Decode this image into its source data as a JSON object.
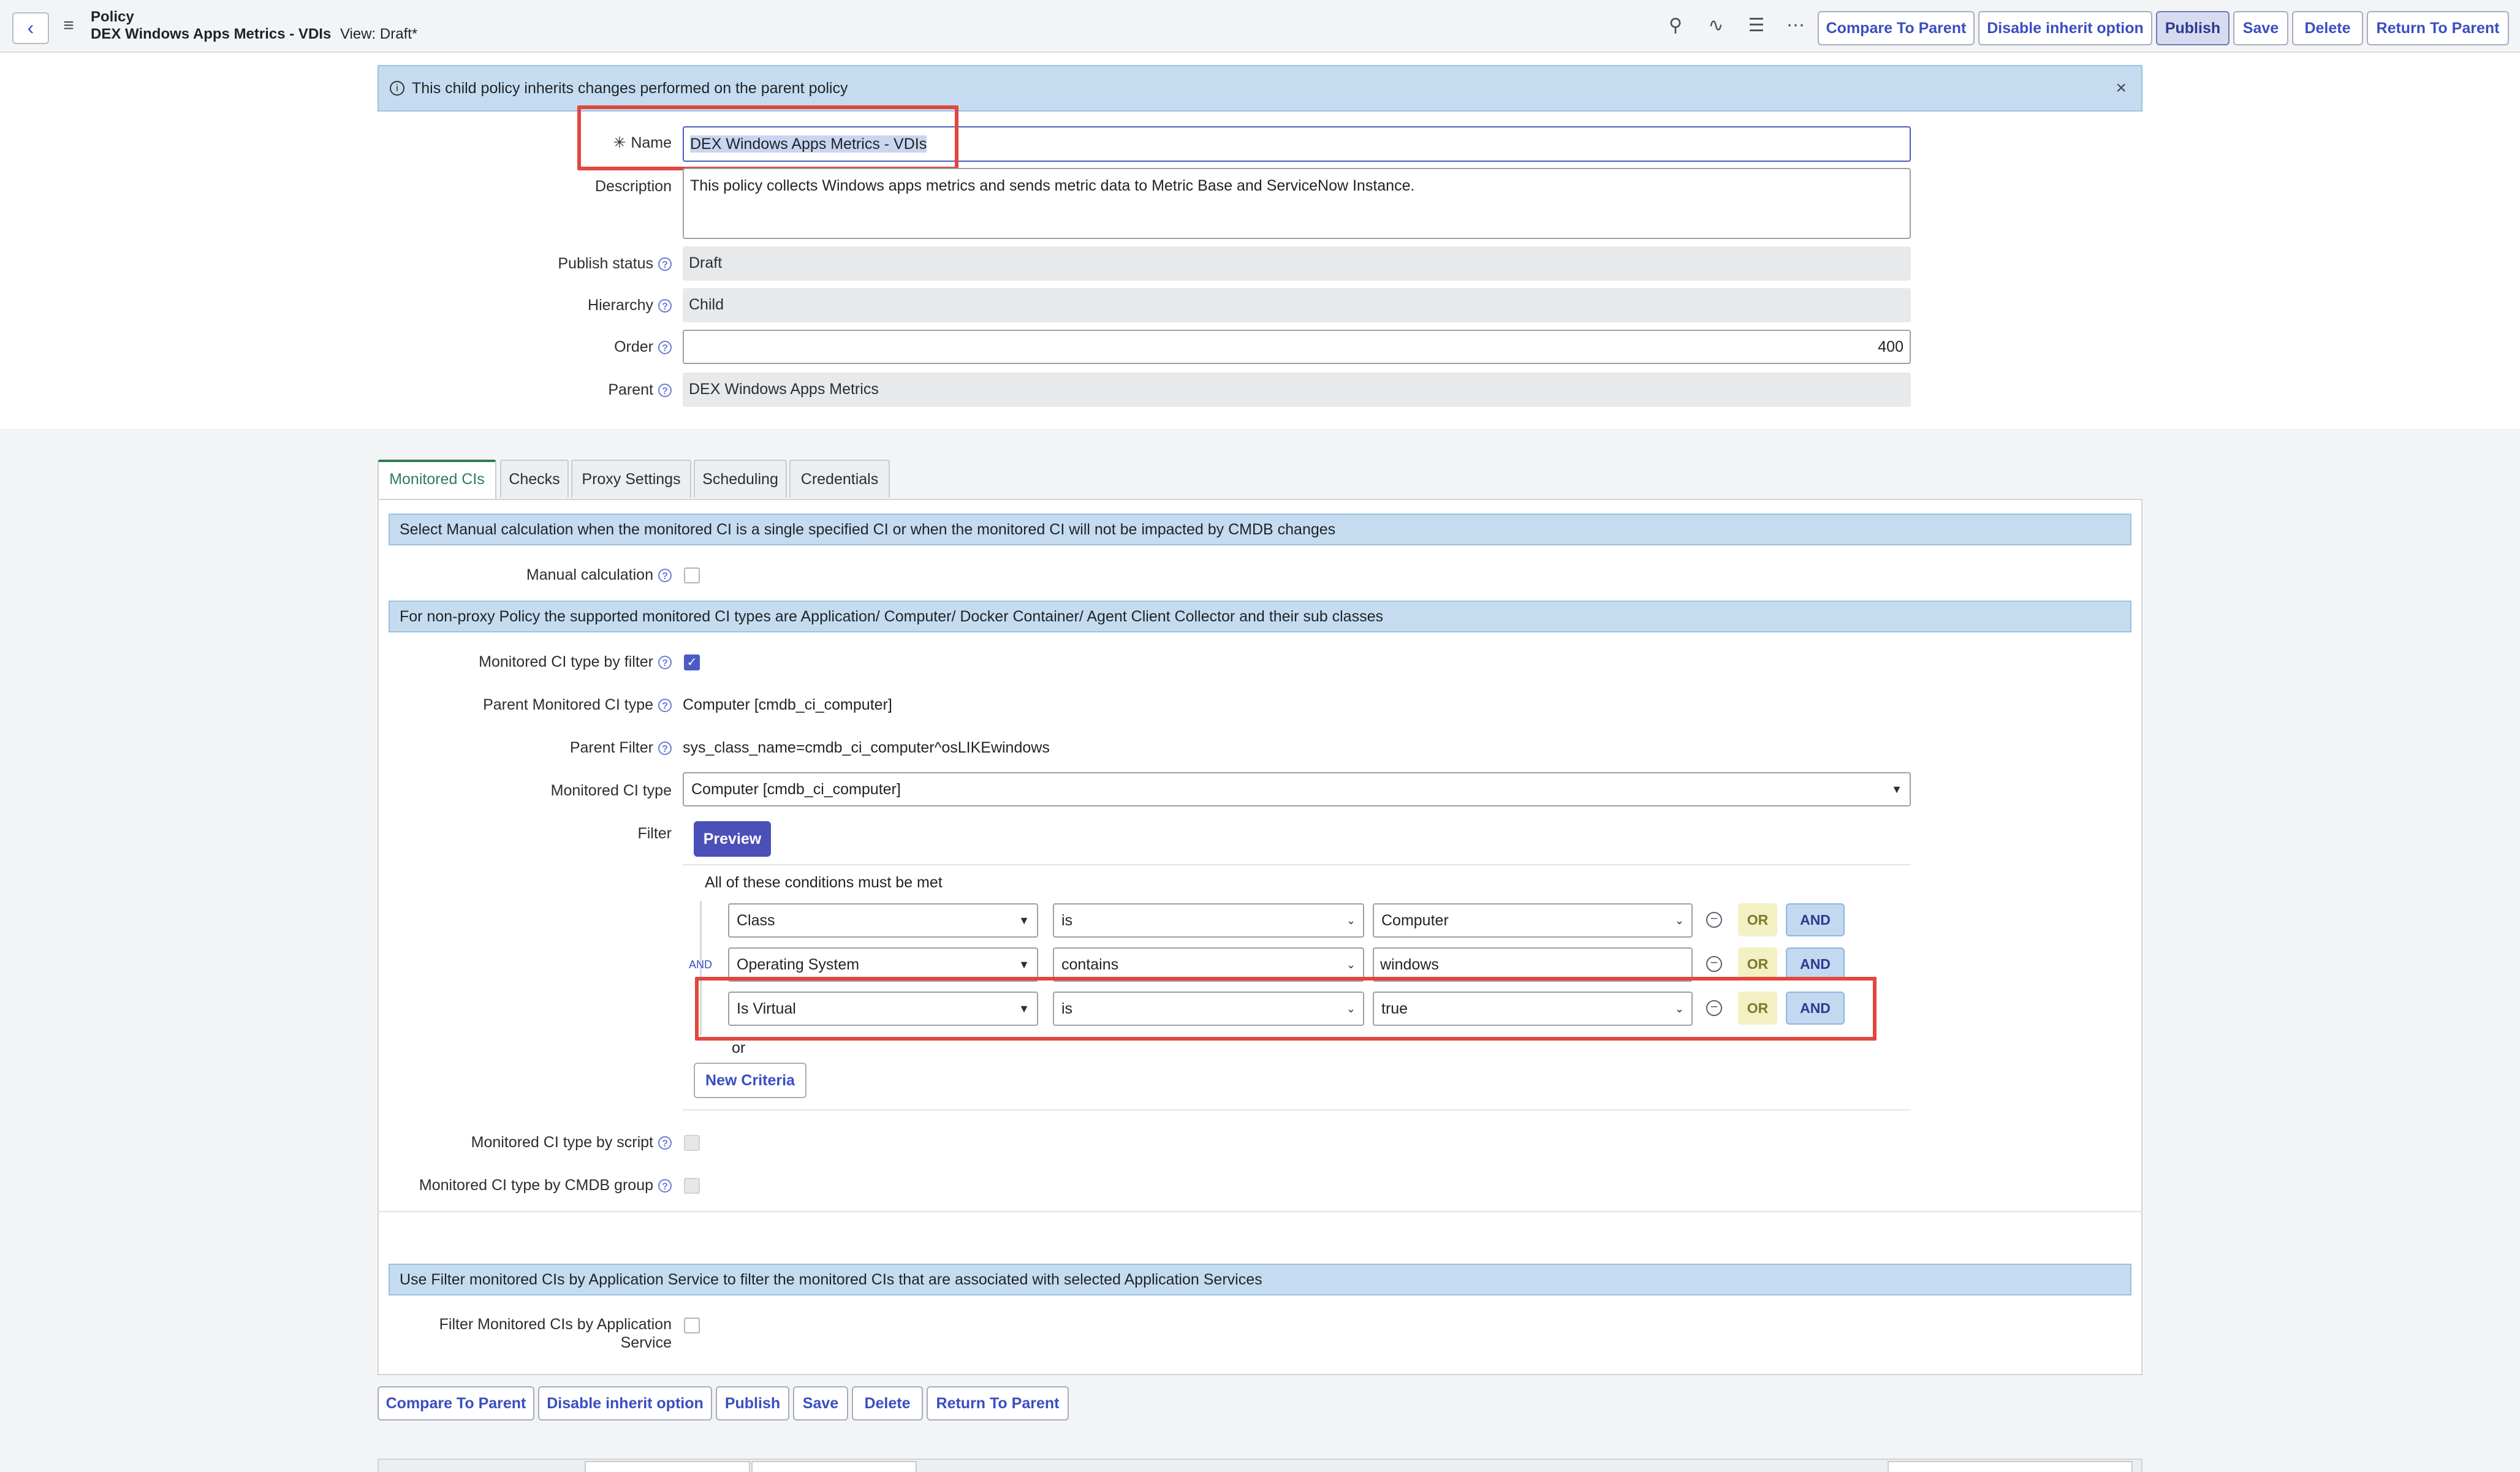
{
  "header": {
    "kicker": "Policy",
    "title": "DEX Windows Apps Metrics - VDIs",
    "view_label": "View: Draft*",
    "buttons": [
      "Compare To Parent",
      "Disable inherit option",
      "Publish",
      "Save",
      "Delete",
      "Return To Parent"
    ]
  },
  "icons": {
    "back": "chevron-left-icon",
    "menu": "hamburger-menu-icon",
    "attachment": "paperclip-icon",
    "activity": "pulse-icon",
    "settings": "sliders-icon",
    "more": "ellipsis-icon",
    "info": "info-icon",
    "close": "close-icon"
  },
  "inherit_notice": "This child policy inherits changes performed on the parent policy",
  "form": {
    "name_label": "Name",
    "name_value": "DEX Windows Apps Metrics - VDIs",
    "description_label": "Description",
    "description_value": "This policy collects Windows apps metrics and sends metric data to Metric Base and ServiceNow Instance.",
    "publish_status_label": "Publish status",
    "publish_status_value": "Draft",
    "hierarchy_label": "Hierarchy",
    "hierarchy_value": "Child",
    "order_label": "Order",
    "order_value": "400",
    "parent_label": "Parent",
    "parent_value": "DEX Windows Apps Metrics"
  },
  "tabs": [
    "Monitored CIs",
    "Checks",
    "Proxy Settings",
    "Scheduling",
    "Credentials"
  ],
  "monitored": {
    "manual_info": "Select Manual calculation when the monitored CI is a single specified CI or when the monitored CI will not be impacted by CMDB changes",
    "manual_label": "Manual calculation",
    "nonproxy_info": "For non-proxy Policy the supported monitored CI types are Application/ Computer/ Docker Container/ Agent Client Collector and their sub classes",
    "by_filter_label": "Monitored CI type by filter",
    "parent_type_label": "Parent Monitored CI type",
    "parent_type_value": "Computer [cmdb_ci_computer]",
    "parent_filter_label": "Parent Filter",
    "parent_filter_value": "sys_class_name=cmdb_ci_computer^osLIKEwindows",
    "type_label": "Monitored CI type",
    "type_value": "Computer [cmdb_ci_computer]",
    "filter_label": "Filter",
    "preview_label": "Preview",
    "conditions_heading": "All of these conditions must be met",
    "and_connector": "AND",
    "or_connector": "or",
    "conditions": [
      {
        "field": "Class",
        "operator": "is",
        "value": "Computer"
      },
      {
        "field": "Operating System",
        "operator": "contains",
        "value": "windows"
      },
      {
        "field": "Is Virtual",
        "operator": "is",
        "value": "true"
      }
    ],
    "or_label": "OR",
    "and_label": "AND",
    "new_criteria_label": "New Criteria",
    "by_script_label": "Monitored CI type by script",
    "by_cmdb_label": "Monitored CI type by CMDB group",
    "app_service_info": "Use Filter monitored CIs by Application Service to filter the monitored CIs that are associated with selected Application Services",
    "app_service_label_1": "Filter Monitored CIs by Application",
    "app_service_label_2": "Service"
  },
  "footer_buttons": [
    "Compare To Parent",
    "Disable inherit option",
    "Publish",
    "Save",
    "Delete",
    "Return To Parent"
  ],
  "colors": {
    "accent": "#3a4ec2",
    "info_bar": "#c5dcf0",
    "highlight": "#e0473e",
    "active_tab": "#2e7d5b"
  }
}
